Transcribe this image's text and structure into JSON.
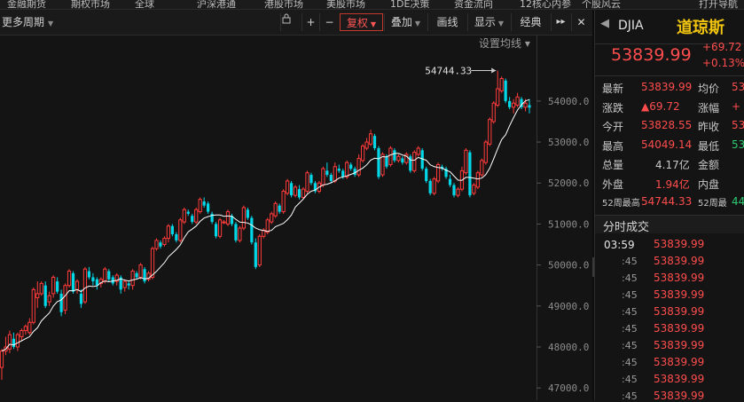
{
  "top_nav": [
    "金融期货",
    "期权市场",
    "全球",
    "沪深港通",
    "港股市场",
    "美股市场",
    "1DE决策",
    "资金流向",
    "12核心内参",
    "个股风云",
    "打开导航"
  ],
  "toolbar": {
    "period_label": "更多周期",
    "lock": "🔒",
    "plus": "+",
    "minus": "−",
    "adjust_label": "复权",
    "overlay_label": "叠加",
    "draw_label": "画线",
    "display_label": "显示",
    "classic_label": "经典",
    "more_label": "▸▸",
    "close_label": "✕"
  },
  "chart_settings_label": "设置均线",
  "quote": {
    "code": "DJIA",
    "name": "道琼斯",
    "price": "53839.99",
    "change": "+69.72",
    "change_pct": "+0.13%",
    "rows": [
      {
        "l1": "最新",
        "v1": "53839.99",
        "l2": "均价",
        "v2": "53"
      },
      {
        "l1": "涨跌",
        "v1": "▲69.72",
        "l2": "涨幅",
        "v2": "+"
      },
      {
        "l1": "今开",
        "v1": "53828.55",
        "l2": "昨收",
        "v2": "53"
      },
      {
        "l1": "最高",
        "v1": "54049.14",
        "l2": "最低",
        "v2": "53"
      },
      {
        "l1": "总量",
        "v1": "4.17亿",
        "l2": "金额",
        "v2": ""
      },
      {
        "l1": "外盘",
        "v1": "1.94亿",
        "l2": "内盘",
        "v2": ""
      },
      {
        "l1": "52周最高",
        "v1": "54744.33",
        "l2": "52周最",
        "v2": "44"
      }
    ]
  },
  "trades": {
    "title": "分时成交",
    "items": [
      {
        "time": "03:59",
        "price": "53839.99"
      },
      {
        "time": ":45",
        "price": "53839.99"
      },
      {
        "time": ":45",
        "price": "53839.99"
      },
      {
        "time": ":45",
        "price": "53839.99"
      },
      {
        "time": ":45",
        "price": "53839.99"
      },
      {
        "time": ":45",
        "price": "53839.99"
      },
      {
        "time": ":45",
        "price": "53839.99"
      },
      {
        "time": ":45",
        "price": "53839.99"
      },
      {
        "time": ":45",
        "price": "53839.99"
      },
      {
        "time": ":45",
        "price": "53839.99"
      }
    ]
  },
  "colors": {
    "up": "#ff3b3b",
    "down": "#00d8e8",
    "ma": "#ffffff",
    "bg": "#141414"
  },
  "chart_data": {
    "type": "candlestick",
    "y_ticks": [
      "54000.0",
      "53000.0",
      "52000.0",
      "51000.0",
      "50000.0",
      "49000.0",
      "48000.0",
      "47000.0"
    ],
    "ylim": [
      46700,
      55600
    ],
    "max_label": "54744.33",
    "candles": [
      [
        47500,
        47900,
        47200,
        47950
      ],
      [
        47900,
        48000,
        47800,
        48250
      ],
      [
        47950,
        48300,
        47850,
        48400
      ],
      [
        48200,
        48000,
        47950,
        48350
      ],
      [
        48000,
        48300,
        47900,
        48350
      ],
      [
        48250,
        48400,
        48150,
        48450
      ],
      [
        48400,
        48500,
        48300,
        48550
      ],
      [
        48350,
        48600,
        48300,
        48700
      ],
      [
        48600,
        49400,
        48550,
        49450
      ],
      [
        49200,
        49300,
        48950,
        49600
      ],
      [
        49300,
        49550,
        49250,
        49600
      ],
      [
        49500,
        49000,
        48950,
        49600
      ],
      [
        49100,
        49250,
        49000,
        49350
      ],
      [
        49300,
        49700,
        49200,
        49750
      ],
      [
        49600,
        49350,
        49300,
        49700
      ],
      [
        49300,
        48850,
        48750,
        49400
      ],
      [
        48900,
        49500,
        48800,
        49550
      ],
      [
        49500,
        49850,
        49450,
        49900
      ],
      [
        49800,
        49350,
        49300,
        49850
      ],
      [
        49400,
        49600,
        49300,
        49650
      ],
      [
        49300,
        49050,
        48950,
        49400
      ],
      [
        49100,
        49900,
        49050,
        49950
      ],
      [
        49850,
        49700,
        49650,
        49950
      ],
      [
        49700,
        49600,
        49500,
        49800
      ],
      [
        49650,
        49500,
        49400,
        49700
      ],
      [
        49550,
        49650,
        49450,
        49700
      ],
      [
        49600,
        49900,
        49550,
        49950
      ],
      [
        49850,
        49650,
        49600,
        49900
      ],
      [
        49700,
        49550,
        49500,
        49750
      ],
      [
        49600,
        49750,
        49500,
        49800
      ],
      [
        49700,
        49400,
        49300,
        49750
      ],
      [
        49450,
        49600,
        49350,
        49650
      ],
      [
        49550,
        49500,
        49400,
        49600
      ],
      [
        49500,
        49850,
        49400,
        49900
      ],
      [
        49800,
        49700,
        49650,
        49850
      ],
      [
        49700,
        50000,
        49650,
        50050
      ],
      [
        49900,
        49600,
        49550,
        49950
      ],
      [
        49650,
        49800,
        49600,
        49850
      ],
      [
        49700,
        50400,
        49650,
        50450
      ],
      [
        50400,
        50600,
        50350,
        50650
      ],
      [
        50550,
        50450,
        50400,
        50600
      ],
      [
        50500,
        50650,
        50450,
        50700
      ],
      [
        50650,
        50950,
        50550,
        51000
      ],
      [
        50950,
        50750,
        50700,
        51000
      ],
      [
        50750,
        50600,
        50550,
        50800
      ],
      [
        50600,
        51100,
        50550,
        51150
      ],
      [
        51050,
        51350,
        51000,
        51400
      ],
      [
        51300,
        51250,
        51200,
        51350
      ],
      [
        51200,
        51050,
        51000,
        51250
      ],
      [
        51050,
        51350,
        51000,
        51400
      ],
      [
        51300,
        51600,
        51250,
        51650
      ],
      [
        51550,
        51450,
        51400,
        51650
      ],
      [
        51500,
        51300,
        51250,
        51550
      ],
      [
        51250,
        51050,
        51000,
        51300
      ],
      [
        51000,
        50700,
        50650,
        51050
      ],
      [
        50700,
        51100,
        50650,
        51150
      ],
      [
        51050,
        51050,
        51000,
        51100
      ],
      [
        51000,
        51300,
        50950,
        51350
      ],
      [
        51200,
        51000,
        50950,
        51250
      ],
      [
        51000,
        50600,
        50550,
        51050
      ],
      [
        50600,
        50900,
        50550,
        50950
      ],
      [
        50900,
        51400,
        50850,
        51450
      ],
      [
        51350,
        51150,
        51100,
        51400
      ],
      [
        51150,
        50550,
        50500,
        51200
      ],
      [
        50550,
        49950,
        49900,
        50650
      ],
      [
        50000,
        50700,
        49950,
        50750
      ],
      [
        50700,
        50850,
        50650,
        50900
      ],
      [
        50800,
        51100,
        50750,
        51150
      ],
      [
        51050,
        51250,
        51000,
        51300
      ],
      [
        51200,
        51500,
        51150,
        51550
      ],
      [
        51450,
        51300,
        51250,
        51500
      ],
      [
        51300,
        51800,
        51250,
        51850
      ],
      [
        51750,
        52050,
        51700,
        52100
      ],
      [
        52000,
        51700,
        51650,
        52050
      ],
      [
        51700,
        51900,
        51650,
        51950
      ],
      [
        51850,
        51650,
        51600,
        51950
      ],
      [
        51650,
        51850,
        51600,
        51900
      ],
      [
        51800,
        52250,
        51750,
        52300
      ],
      [
        52200,
        52000,
        51950,
        52250
      ],
      [
        52000,
        51800,
        51750,
        52050
      ],
      [
        51800,
        52000,
        51750,
        52050
      ],
      [
        51950,
        52350,
        51900,
        52400
      ],
      [
        52300,
        52200,
        52150,
        52500
      ],
      [
        52200,
        52050,
        52000,
        52250
      ],
      [
        52050,
        52400,
        52000,
        52500
      ],
      [
        52350,
        52300,
        52250,
        52450
      ],
      [
        52300,
        52150,
        52100,
        52350
      ],
      [
        52150,
        52500,
        52100,
        52550
      ],
      [
        52450,
        52350,
        52300,
        52500
      ],
      [
        52350,
        52200,
        52150,
        52400
      ],
      [
        52200,
        52600,
        52150,
        52700
      ],
      [
        52550,
        52900,
        52500,
        52950
      ],
      [
        52850,
        53000,
        52800,
        53100
      ],
      [
        52950,
        53200,
        52900,
        53300
      ],
      [
        53150,
        52850,
        52800,
        53200
      ],
      [
        52850,
        52150,
        52100,
        52900
      ],
      [
        52200,
        52700,
        52150,
        52750
      ],
      [
        52650,
        52400,
        52350,
        52700
      ],
      [
        52450,
        52850,
        52400,
        52900
      ],
      [
        52800,
        52550,
        52500,
        52850
      ],
      [
        52550,
        52650,
        52500,
        52700
      ],
      [
        52600,
        52500,
        52450,
        52650
      ],
      [
        52500,
        52700,
        52450,
        52750
      ],
      [
        52650,
        52300,
        52250,
        52700
      ],
      [
        52300,
        52750,
        52250,
        52800
      ],
      [
        52700,
        52850,
        52650,
        52900
      ],
      [
        52800,
        52350,
        52300,
        52850
      ],
      [
        52350,
        52050,
        52000,
        52400
      ],
      [
        52050,
        51750,
        51700,
        52100
      ],
      [
        51750,
        52100,
        51700,
        52150
      ],
      [
        52050,
        52450,
        52000,
        52500
      ],
      [
        52400,
        52350,
        52300,
        52450
      ],
      [
        52350,
        52150,
        52100,
        52400
      ],
      [
        52100,
        51950,
        51900,
        52200
      ],
      [
        51950,
        51700,
        51650,
        52000
      ],
      [
        51700,
        51850,
        51650,
        51900
      ],
      [
        51850,
        52300,
        51800,
        52400
      ],
      [
        52250,
        52800,
        52200,
        52850
      ],
      [
        52750,
        51700,
        51650,
        52800
      ],
      [
        51750,
        51950,
        51700,
        52000
      ],
      [
        51900,
        52250,
        51850,
        52300
      ],
      [
        52200,
        52550,
        52150,
        52600
      ],
      [
        52500,
        53000,
        52450,
        53050
      ],
      [
        52950,
        53550,
        52900,
        53600
      ],
      [
        53500,
        53950,
        53450,
        54000
      ],
      [
        53900,
        54300,
        53850,
        54744.33
      ],
      [
        54250,
        54550,
        54200,
        54600
      ],
      [
        54500,
        54000,
        53950,
        54550
      ],
      [
        54000,
        53850,
        53800,
        54100
      ],
      [
        53850,
        53950,
        53700,
        54050
      ],
      [
        53900,
        54100,
        53850,
        54200
      ],
      [
        54050,
        53850,
        53800,
        54100
      ],
      [
        53850,
        53950,
        53750,
        54050
      ],
      [
        53900,
        53840,
        53700,
        54049
      ]
    ]
  }
}
